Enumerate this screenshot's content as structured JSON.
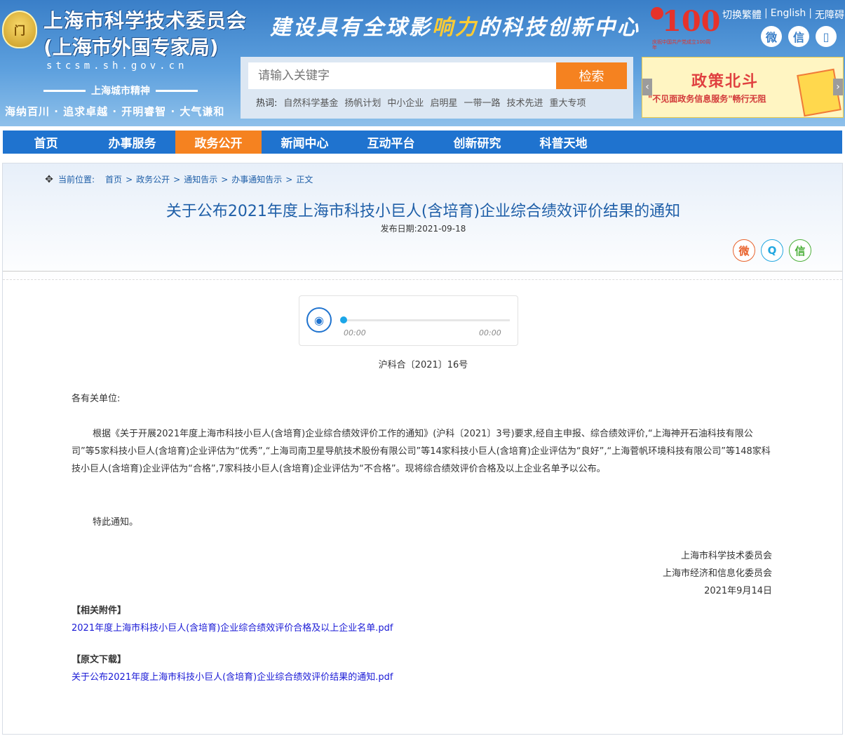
{
  "header": {
    "emblem_text": "门",
    "title": "上海市科学技术委员会",
    "subtitle": "(上海市外国专家局)",
    "url": "stcsm.sh.gov.cn",
    "spirit_label": "上海城市精神",
    "motto": "海纳百川 · 追求卓越 · 开明睿智 · 大气谦和",
    "slogan_a": "建设具有全球影",
    "slogan_b": "响力",
    "slogan_c": "的科技创新中心",
    "anniv_num": "100",
    "anniv_caption": "庆祝中国共产党成立100周年",
    "langs": [
      "切换繁體",
      "English",
      "无障碍"
    ],
    "social": [
      {
        "icon": "weibo-icon",
        "glyph": "微"
      },
      {
        "icon": "wechat-icon",
        "glyph": "信"
      },
      {
        "icon": "mobile-icon",
        "glyph": "▯"
      }
    ]
  },
  "search": {
    "placeholder": "请输入关键字",
    "button": "检索",
    "hot_label": "热词:",
    "hot_words": [
      "自然科学基金",
      "扬帆计划",
      "中小企业",
      "启明星",
      "一带一路",
      "技术先进",
      "重大专项"
    ]
  },
  "banner": {
    "title": "政策北斗",
    "text": "\"不见面政务信息服务\"畅行无阻",
    "prev": "‹",
    "next": "›"
  },
  "nav": {
    "items": [
      "首页",
      "办事服务",
      "政务公开",
      "新闻中心",
      "互动平台",
      "创新研究",
      "科普天地"
    ],
    "active_index": 2
  },
  "breadcrumb": {
    "label": "当前位置:",
    "items": [
      "首页",
      "政务公开",
      "通知告示",
      "办事通知告示",
      "正文"
    ]
  },
  "article": {
    "title": "关于公布2021年度上海市科技小巨人(含培育)企业综合绩效评价结果的通知",
    "date": "发布日期:2021-09-18",
    "share": [
      {
        "icon": "weibo-share-icon",
        "glyph": "微",
        "color": "#e8622c"
      },
      {
        "icon": "qq-share-icon",
        "glyph": "Q",
        "color": "#22a7e0"
      },
      {
        "icon": "wechat-share-icon",
        "glyph": "信",
        "color": "#4caf3a"
      }
    ],
    "player": {
      "current": "00:00",
      "duration": "00:00"
    },
    "doc_no": "沪科合〔2021〕16号",
    "salutation": "各有关单位:",
    "paragraph": "根据《关于开展2021年度上海市科技小巨人(含培育)企业综合绩效评价工作的通知》(沪科〔2021〕3号)要求,经自主申报、综合绩效评价,“上海神开石油科技有限公司”等5家科技小巨人(含培育)企业评估为“优秀”,“上海司南卫星导航技术股份有限公司”等14家科技小巨人(含培育)企业评估为“良好”,“上海菅帆环境科技有限公司”等148家科技小巨人(含培育)企业评估为“合格”,7家科技小巨人(含培育)企业评估为“不合格”。现将综合绩效评价合格及以上企业名单予以公布。",
    "closing": "特此通知。",
    "signers": [
      "上海市科学技术委员会",
      "上海市经济和信息化委员会",
      "2021年9月14日"
    ],
    "attach_heading": "【相关附件】",
    "attach_link": "2021年度上海市科技小巨人(含培育)企业综合绩效评价合格及以上企业名单.pdf",
    "original_heading": "【原文下载】",
    "original_link": "关于公布2021年度上海市科技小巨人(含培育)企业综合绩效评价结果的通知.pdf"
  },
  "colors": {
    "nav_bg": "#1f73cf",
    "accent": "#f58220",
    "title": "#1f5fa8",
    "link": "#1a1ad6"
  }
}
